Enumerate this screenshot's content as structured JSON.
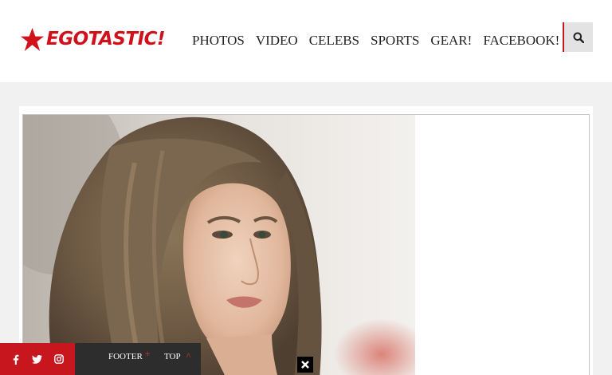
{
  "brand": {
    "name": "EGOTASTIC!",
    "accent_color": "#d0111b"
  },
  "nav": {
    "items": [
      {
        "label": "PHOTOS"
      },
      {
        "label": "VIDEO"
      },
      {
        "label": "CELEBS"
      },
      {
        "label": "SPORTS"
      },
      {
        "label": "GEAR!"
      },
      {
        "label": "FACEBOOK!"
      }
    ],
    "search_icon": "search-icon"
  },
  "main": {
    "photo": "portrait-photo"
  },
  "bottom_bar": {
    "social": [
      "facebook-icon",
      "twitter-icon",
      "instagram-icon"
    ],
    "footer_label": "FOOTER",
    "footer_symbol": "+",
    "top_label": "TOP",
    "top_symbol": "^",
    "close_icon": "close-icon"
  }
}
